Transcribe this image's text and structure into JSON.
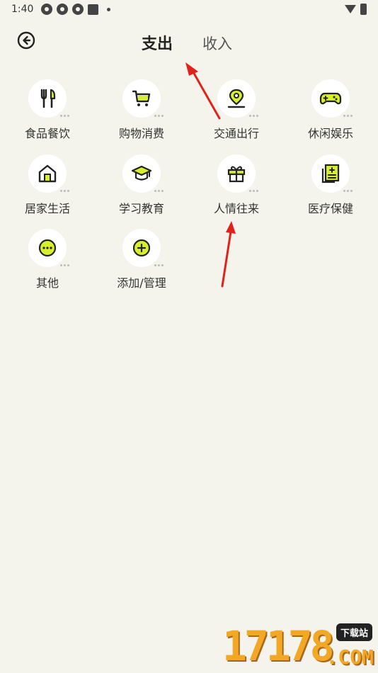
{
  "status_bar": {
    "time": "1:40"
  },
  "header": {
    "tabs": [
      {
        "label": "支出",
        "active": true
      },
      {
        "label": "收入",
        "active": false
      }
    ]
  },
  "categories": [
    {
      "label": "食品餐饮",
      "icon": "fork-knife-icon"
    },
    {
      "label": "购物消费",
      "icon": "shopping-cart-icon"
    },
    {
      "label": "交通出行",
      "icon": "map-pin-icon"
    },
    {
      "label": "休闲娱乐",
      "icon": "gamepad-icon"
    },
    {
      "label": "居家生活",
      "icon": "home-icon"
    },
    {
      "label": "学习教育",
      "icon": "graduation-cap-icon"
    },
    {
      "label": "人情往来",
      "icon": "gift-icon"
    },
    {
      "label": "医疗保健",
      "icon": "medical-record-icon"
    },
    {
      "label": "其他",
      "icon": "more-icon"
    },
    {
      "label": "添加/管理",
      "icon": "add-icon"
    }
  ],
  "colors": {
    "background": "#f4f4ec",
    "accent": "#d8f02c",
    "annotation_arrow": "#e0221c"
  },
  "watermark": {
    "number": "17178",
    "badge": "下载站",
    "suffix": ".COM"
  }
}
